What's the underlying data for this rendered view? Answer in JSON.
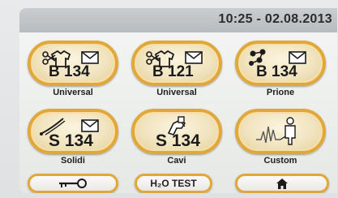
{
  "status_bar": {
    "datetime": "10:25 - 02.08.2013"
  },
  "programs": [
    {
      "code": "B 134",
      "label": "Universal",
      "icon": "shirt-scissors-icon",
      "has_envelope": true
    },
    {
      "code": "B 121",
      "label": "Universal",
      "icon": "shirt-scissors-icon",
      "has_envelope": true
    },
    {
      "code": "B 134",
      "label": "Prione",
      "icon": "chain-links-icon",
      "has_envelope": true
    },
    {
      "code": "S 134",
      "label": "Solidi",
      "icon": "welding-rod-icon",
      "has_envelope": true
    },
    {
      "code": "S 134",
      "label": "Cavi",
      "icon": "welding-machine-icon",
      "has_envelope": false
    },
    {
      "code": "",
      "label": "Custom",
      "icon": "person-waveform-icon",
      "has_envelope": false
    }
  ],
  "bottom_bar": {
    "key_icon": "key-icon",
    "h2o_test_label": "H₂O TEST",
    "home_icon": "home-icon"
  },
  "colors": {
    "accent": "#e2a739",
    "button_fill": "#f1e4bf",
    "status_bar": "#bcc1c4"
  }
}
